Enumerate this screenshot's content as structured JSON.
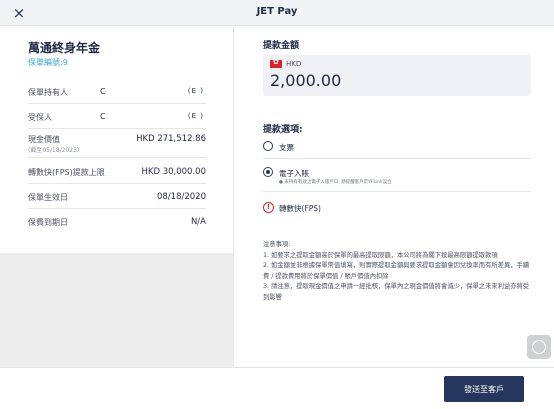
{
  "header": {
    "close_glyph": "×",
    "title": "JET Pay"
  },
  "policy": {
    "name": "萬通終身年金",
    "number": "保單編號:9",
    "rows": [
      {
        "label": "保單持有人",
        "masked_prefix": "C",
        "masked_value": "(E    )"
      },
      {
        "label": "受保人",
        "masked_prefix": "C",
        "masked_value": "(E    )"
      },
      {
        "label": "現金價值",
        "sublabel": "(截至05/18/2023)",
        "value": "HKD 271,512.86"
      },
      {
        "label": "轉數快(FPS)提款上限",
        "value": "HKD 30,000.00"
      },
      {
        "label": "保單生效日",
        "value": "08/18/2020"
      },
      {
        "label": "保費到期日",
        "value": "N/A"
      }
    ]
  },
  "withdrawal": {
    "amount_title": "提款金額",
    "currency": "HKD",
    "amount": "2,000.00",
    "options_title": "提款選項:",
    "options": [
      {
        "label": "支票",
        "selected": false
      },
      {
        "label": "電子入賬",
        "sublabel": "● 未持有有效之電子入賬戶口, 請提醒客戶於YFLink設立",
        "selected": true
      },
      {
        "label": "轉數快(FPS)",
        "icon": "warning-icon"
      }
    ]
  },
  "notes": {
    "title": "注意事項:",
    "items": [
      "1. 如要求之提取金額高於保單的最高提取限額，本公司將為閣下按最高限額提取款項",
      "2. 如金額並非根據保單幣值填寫，則實際提取金額與要求提取金額會因兌換率而有所差異，手續費 / 提款費用將於保單價值 / 賬戶價值內扣除",
      "3. 請注意，提取現金價值之申請一經批核，保單內之現金價值將會減少，保單之未來利益亦將受到影響"
    ]
  },
  "footer": {
    "send_label": "發送至客戶"
  },
  "colors": {
    "primary": "#27365c",
    "accent_link": "#3aa6d8",
    "warning": "#d6242c",
    "panel_bg": "#ededed"
  }
}
